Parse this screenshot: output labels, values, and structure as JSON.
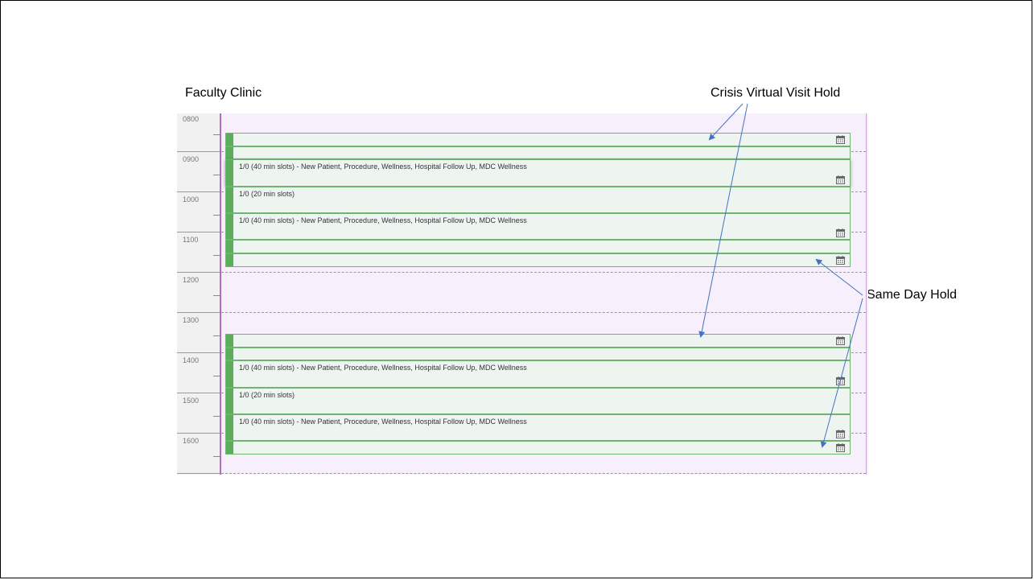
{
  "annotations": {
    "faculty_clinic": "Faculty Clinic",
    "crisis_hold": "Crisis Virtual Visit Hold",
    "same_day_hold": "Same Day Hold"
  },
  "hours": [
    "0800",
    "0900",
    "1000",
    "1100",
    "1200",
    "1300",
    "1400",
    "1500",
    "1600"
  ],
  "blocks": [
    {
      "label": "",
      "icon": "calendar-icon"
    },
    {
      "label": "",
      "icon": ""
    },
    {
      "label": "1/0 (40 min slots) - New Patient, Procedure, Wellness, Hospital Follow Up, MDC Wellness",
      "icon": "calendar-icon"
    },
    {
      "label": "1/0 (20 min slots)",
      "icon": ""
    },
    {
      "label": "1/0 (40 min slots) - New Patient, Procedure, Wellness, Hospital Follow Up, MDC Wellness",
      "icon": "calendar-icon"
    },
    {
      "label": "",
      "icon": ""
    },
    {
      "label": "",
      "icon": "calendar-icon"
    },
    {
      "label": "",
      "icon": "calendar-icon"
    },
    {
      "label": "",
      "icon": ""
    },
    {
      "label": "1/0 (40 min slots) - New Patient, Procedure, Wellness, Hospital Follow Up, MDC Wellness",
      "icon": "calendar-icon"
    },
    {
      "label": "1/0 (20 min slots)",
      "icon": ""
    },
    {
      "label": "1/0 (40 min slots) - New Patient, Procedure, Wellness, Hospital Follow Up, MDC Wellness",
      "icon": "calendar-icon"
    },
    {
      "label": "",
      "icon": "calendar-icon"
    }
  ],
  "colors": {
    "block_fill": "#eef5f1",
    "block_border": "#6fb46f",
    "block_bar": "#5bae5b",
    "day_background": "#f7effb",
    "arrow": "#4472c4"
  }
}
